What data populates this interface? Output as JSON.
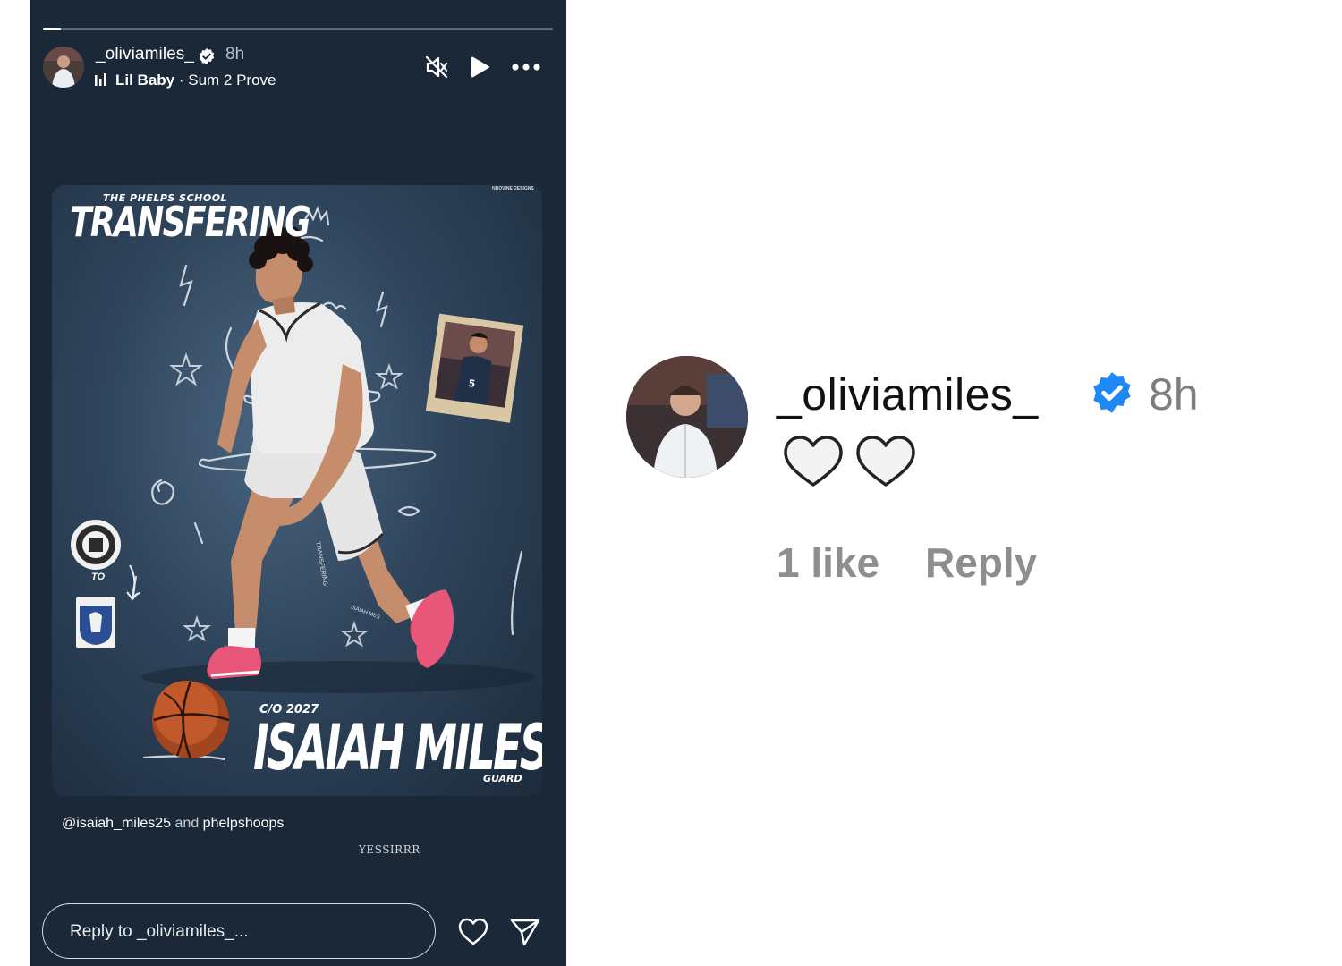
{
  "story": {
    "progress": 0.035,
    "username": "_oliviamiles_",
    "time": "8h",
    "music_artist": "Lil Baby",
    "music_separator": " · ",
    "music_song": "Sum 2 Prove",
    "icons": {
      "mute": "speaker-muted-icon",
      "play": "play-icon",
      "more": "more-dots-icon",
      "like": "heart-icon",
      "share": "send-icon",
      "verified": "verified-badge-icon",
      "music": "music-bars-icon"
    },
    "poster": {
      "kicker": "THE PHELPS SCHOOL",
      "title": "TRANSFERING",
      "credit": "NBOVINE DESIGNS",
      "class_label": "C/O 2027",
      "player_name": "ISAIAH MILES",
      "position": "GUARD",
      "to_label": "TO",
      "jersey_number": "5",
      "handwrite_vertical": "TRANSFERING",
      "handwrite_signature": "ISAIAH MES"
    },
    "mentions": {
      "user": "@isaiah_miles25",
      "conj": " and ",
      "team": "phelpshoops"
    },
    "sticker_text": "YESSIRRR",
    "reply_placeholder": "Reply to _oliviamiles_..."
  },
  "comment": {
    "username": "_oliviamiles_",
    "time": "8h",
    "text": "🤍🤍",
    "likes": "1 like",
    "reply": "Reply"
  },
  "colors": {
    "story_bg": "#1b2838",
    "verified_blue": "#1e88f5",
    "shoe_pink": "#e8577a"
  }
}
